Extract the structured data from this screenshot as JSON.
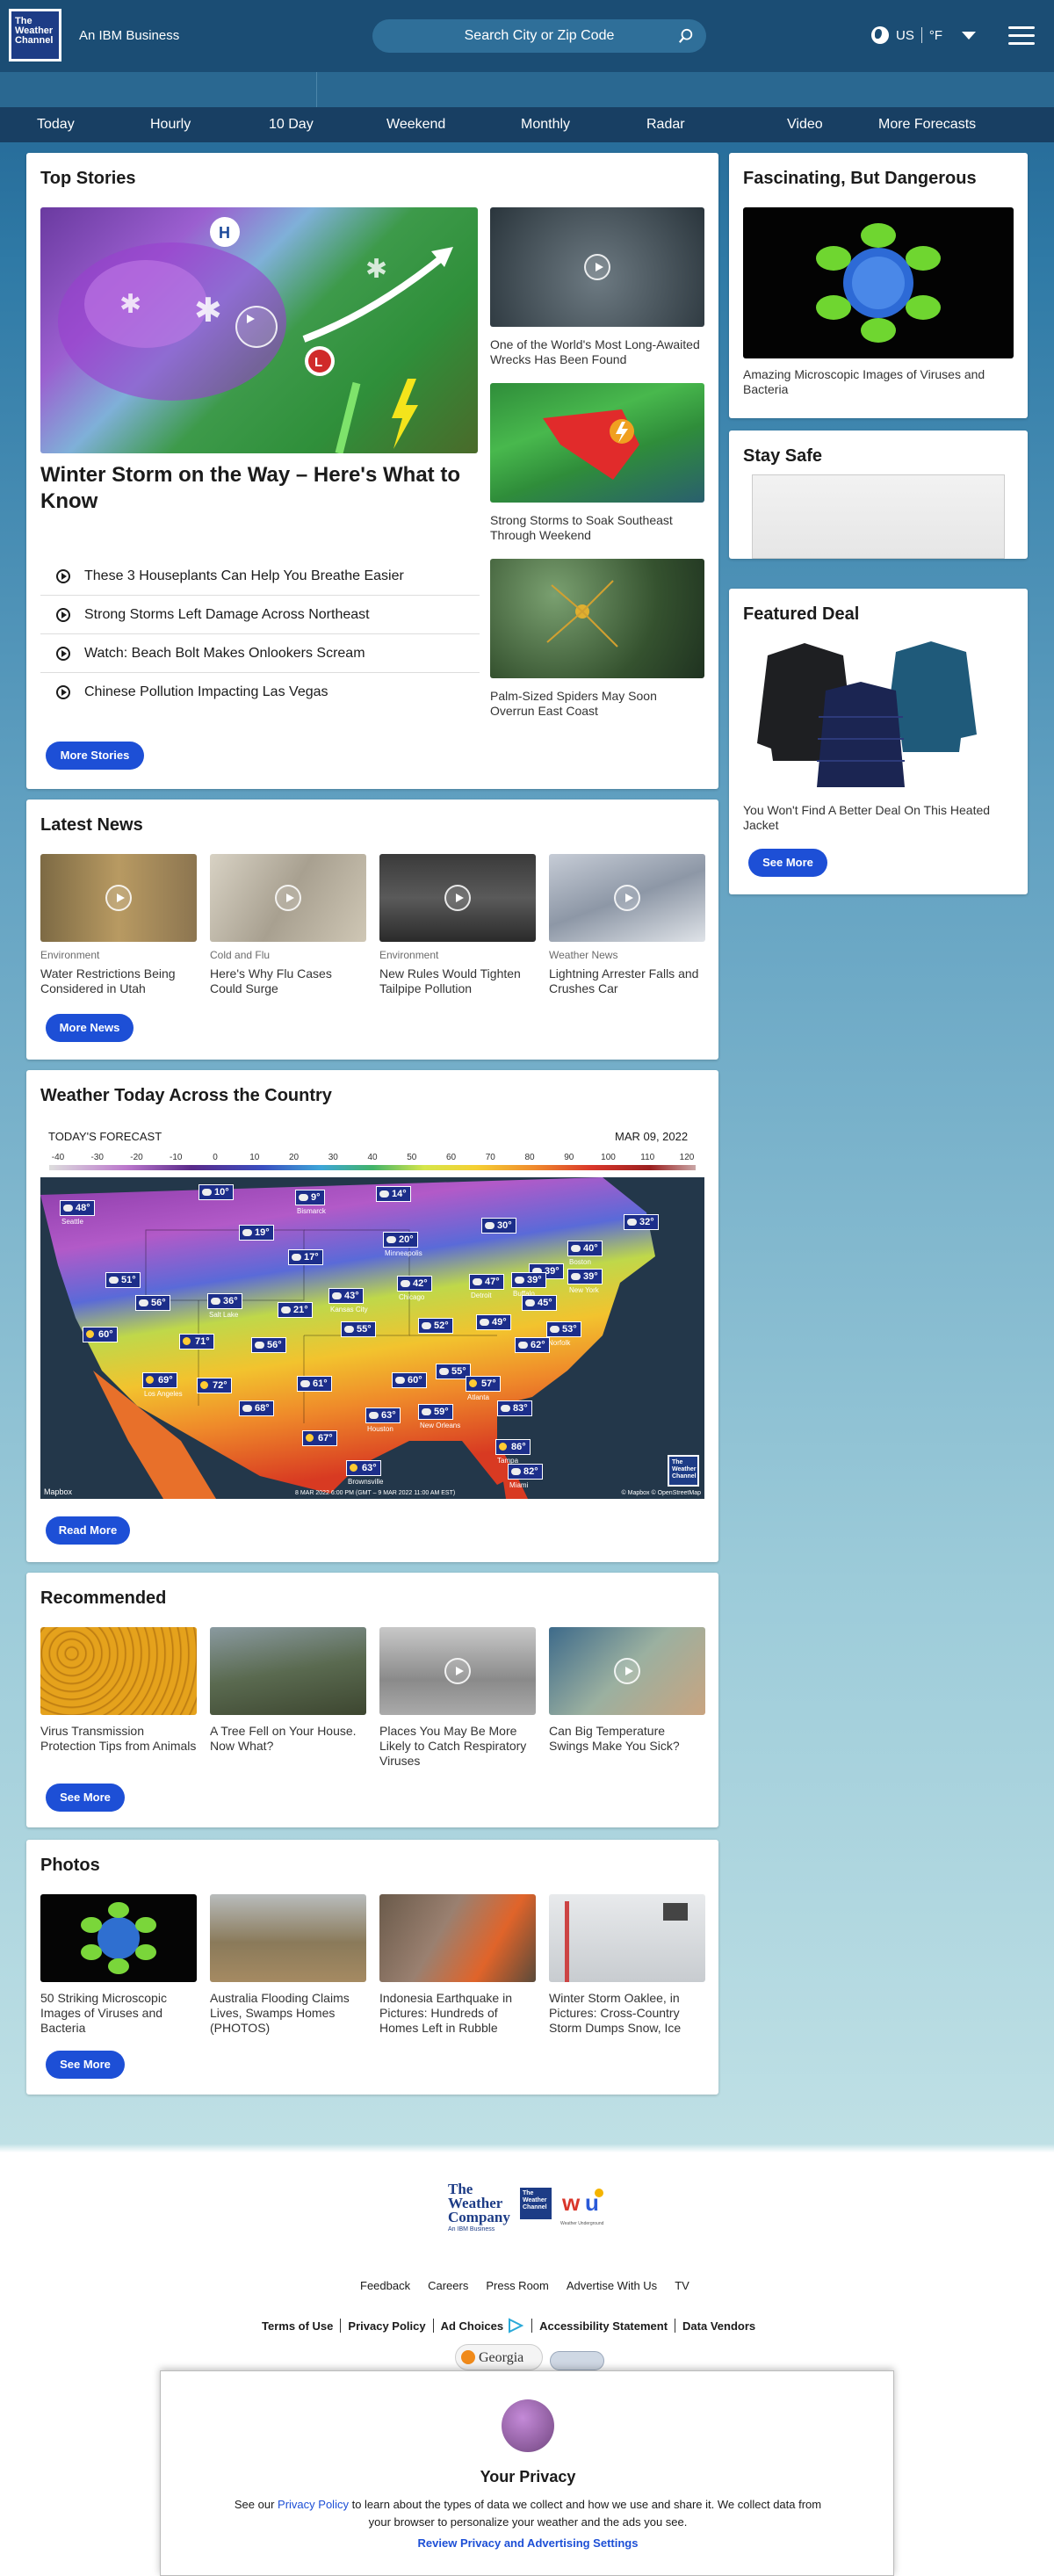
{
  "header": {
    "logo_text": "The Weather Channel",
    "tagline": "An IBM Business",
    "search_placeholder": "Search City or Zip Code",
    "country": "US",
    "unit": "°F"
  },
  "nav": {
    "items": [
      "Today",
      "Hourly",
      "10 Day",
      "Weekend",
      "Monthly",
      "Radar",
      "Video",
      "More Forecasts"
    ]
  },
  "top_stories": {
    "title": "Top Stories",
    "hero_headline": "Winter Storm on the Way – Here's What to Know",
    "list": [
      "These 3 Houseplants Can Help You Breathe Easier",
      "Strong Storms Left Damage Across Northeast",
      "Watch: Beach Bolt Makes Onlookers Scream",
      "Chinese Pollution Impacting Las Vegas"
    ],
    "side": [
      "One of the World's Most Long-Awaited Wrecks Has Been Found",
      "Strong Storms to Soak Southeast Through Weekend",
      "Palm-Sized Spiders May Soon Overrun East Coast"
    ],
    "button": "More Stories"
  },
  "latest_news": {
    "title": "Latest News",
    "items": [
      {
        "category": "Environment",
        "caption": "Water Restrictions Being Considered in Utah"
      },
      {
        "category": "Cold and Flu",
        "caption": "Here's Why Flu Cases Could Surge"
      },
      {
        "category": "Environment",
        "caption": "New Rules Would Tighten Tailpipe Pollution"
      },
      {
        "category": "Weather News",
        "caption": "Lightning Arrester Falls and Crushes Car"
      }
    ],
    "button": "More News"
  },
  "weather_today": {
    "title": "Weather Today Across the Country",
    "forecast_label": "TODAY'S FORECAST",
    "date": "MAR 09, 2022",
    "scale": [
      "-40",
      "-30",
      "-20",
      "-10",
      "0",
      "10",
      "20",
      "30",
      "40",
      "50",
      "60",
      "70",
      "80",
      "90",
      "100",
      "110",
      "120"
    ],
    "temps": [
      {
        "t": "48°",
        "city": "Seattle"
      },
      {
        "t": "10°",
        "city": ""
      },
      {
        "t": "9°",
        "city": "Bismarck"
      },
      {
        "t": "14°",
        "city": ""
      },
      {
        "t": "19°",
        "city": ""
      },
      {
        "t": "20°",
        "city": "Minneapolis"
      },
      {
        "t": "30°",
        "city": ""
      },
      {
        "t": "32°",
        "city": ""
      },
      {
        "t": "17°",
        "city": ""
      },
      {
        "t": "40°",
        "city": "Boston"
      },
      {
        "t": "39°",
        "city": ""
      },
      {
        "t": "51°",
        "city": ""
      },
      {
        "t": "56°",
        "city": ""
      },
      {
        "t": "42°",
        "city": "Chicago"
      },
      {
        "t": "47°",
        "city": "Detroit"
      },
      {
        "t": "39°",
        "city": "Buffalo"
      },
      {
        "t": "39°",
        "city": "New York"
      },
      {
        "t": "43°",
        "city": "Kansas City"
      },
      {
        "t": "36°",
        "city": "Salt Lake"
      },
      {
        "t": "21°",
        "city": ""
      },
      {
        "t": "45°",
        "city": ""
      },
      {
        "t": "60°",
        "city": ""
      },
      {
        "t": "71°",
        "city": ""
      },
      {
        "t": "55°",
        "city": ""
      },
      {
        "t": "52°",
        "city": ""
      },
      {
        "t": "49°",
        "city": ""
      },
      {
        "t": "53°",
        "city": "Norfolk"
      },
      {
        "t": "56°",
        "city": ""
      },
      {
        "t": "62°",
        "city": ""
      },
      {
        "t": "69°",
        "city": "Los Angeles"
      },
      {
        "t": "72°",
        "city": ""
      },
      {
        "t": "61°",
        "city": ""
      },
      {
        "t": "60°",
        "city": ""
      },
      {
        "t": "55°",
        "city": ""
      },
      {
        "t": "57°",
        "city": "Atlanta"
      },
      {
        "t": "68°",
        "city": ""
      },
      {
        "t": "63°",
        "city": "Houston"
      },
      {
        "t": "59°",
        "city": "New Orleans"
      },
      {
        "t": "83°",
        "city": ""
      },
      {
        "t": "67°",
        "city": ""
      },
      {
        "t": "86°",
        "city": "Tampa"
      },
      {
        "t": "63°",
        "city": "Brownsville"
      },
      {
        "t": "82°",
        "city": "Miami"
      }
    ],
    "map_footer_left": "Mapbox",
    "map_footer_time": "8 MAR 2022 6:00 PM (GMT – 9 MAR 2022 11:00 AM EST)",
    "map_footer_right": "© Mapbox © OpenStreetMap",
    "map_logo": "The Weather Channel",
    "button": "Read More"
  },
  "recommended": {
    "title": "Recommended",
    "items": [
      "Virus Transmission Protection Tips from Animals",
      "A Tree Fell on Your House. Now What?",
      "Places You May Be More Likely to Catch Respiratory Viruses",
      "Can Big Temperature Swings Make You Sick?"
    ],
    "button": "See More"
  },
  "photos": {
    "title": "Photos",
    "items": [
      "50 Striking Microscopic Images of Viruses and Bacteria",
      "Australia Flooding Claims Lives, Swamps Homes (PHOTOS)",
      "Indonesia Earthquake in Pictures: Hundreds of Homes Left in Rubble",
      "Winter Storm Oaklee, in Pictures: Cross-Country Storm Dumps Snow, Ice"
    ],
    "button": "See More"
  },
  "sidebar": {
    "fascinating": {
      "title": "Fascinating, But Dangerous",
      "caption": "Amazing Microscopic Images of Viruses and Bacteria"
    },
    "stay_safe": {
      "title": "Stay Safe"
    },
    "deal": {
      "title": "Featured Deal",
      "caption": "You Won't Find A Better Deal On This Heated Jacket",
      "button": "See More"
    }
  },
  "footer": {
    "brand_logos": [
      "The Weather Company",
      "The Weather Channel",
      "Weather Underground"
    ],
    "brand_sub": "An IBM Business",
    "links_row1": [
      "Feedback",
      "Careers",
      "Press Room",
      "Advertise With Us",
      "TV"
    ],
    "links_row2": [
      "Terms of Use",
      "Privacy Policy",
      "Ad Choices",
      "Accessibility Statement",
      "Data Vendors"
    ],
    "badge": "Georgia"
  },
  "privacy": {
    "title": "Your Privacy",
    "text_before": "See our",
    "link": "Privacy Policy",
    "text_after": "to learn about the types of data we collect and how we use and share it. We collect data from your browser to personalize your weather and the ads you see.",
    "review": "Review Privacy and Advertising Settings"
  },
  "colors": {
    "header": "#1b4d74",
    "nav": "#183f63",
    "button": "#1d4fd6",
    "link": "#1d4fd6"
  }
}
